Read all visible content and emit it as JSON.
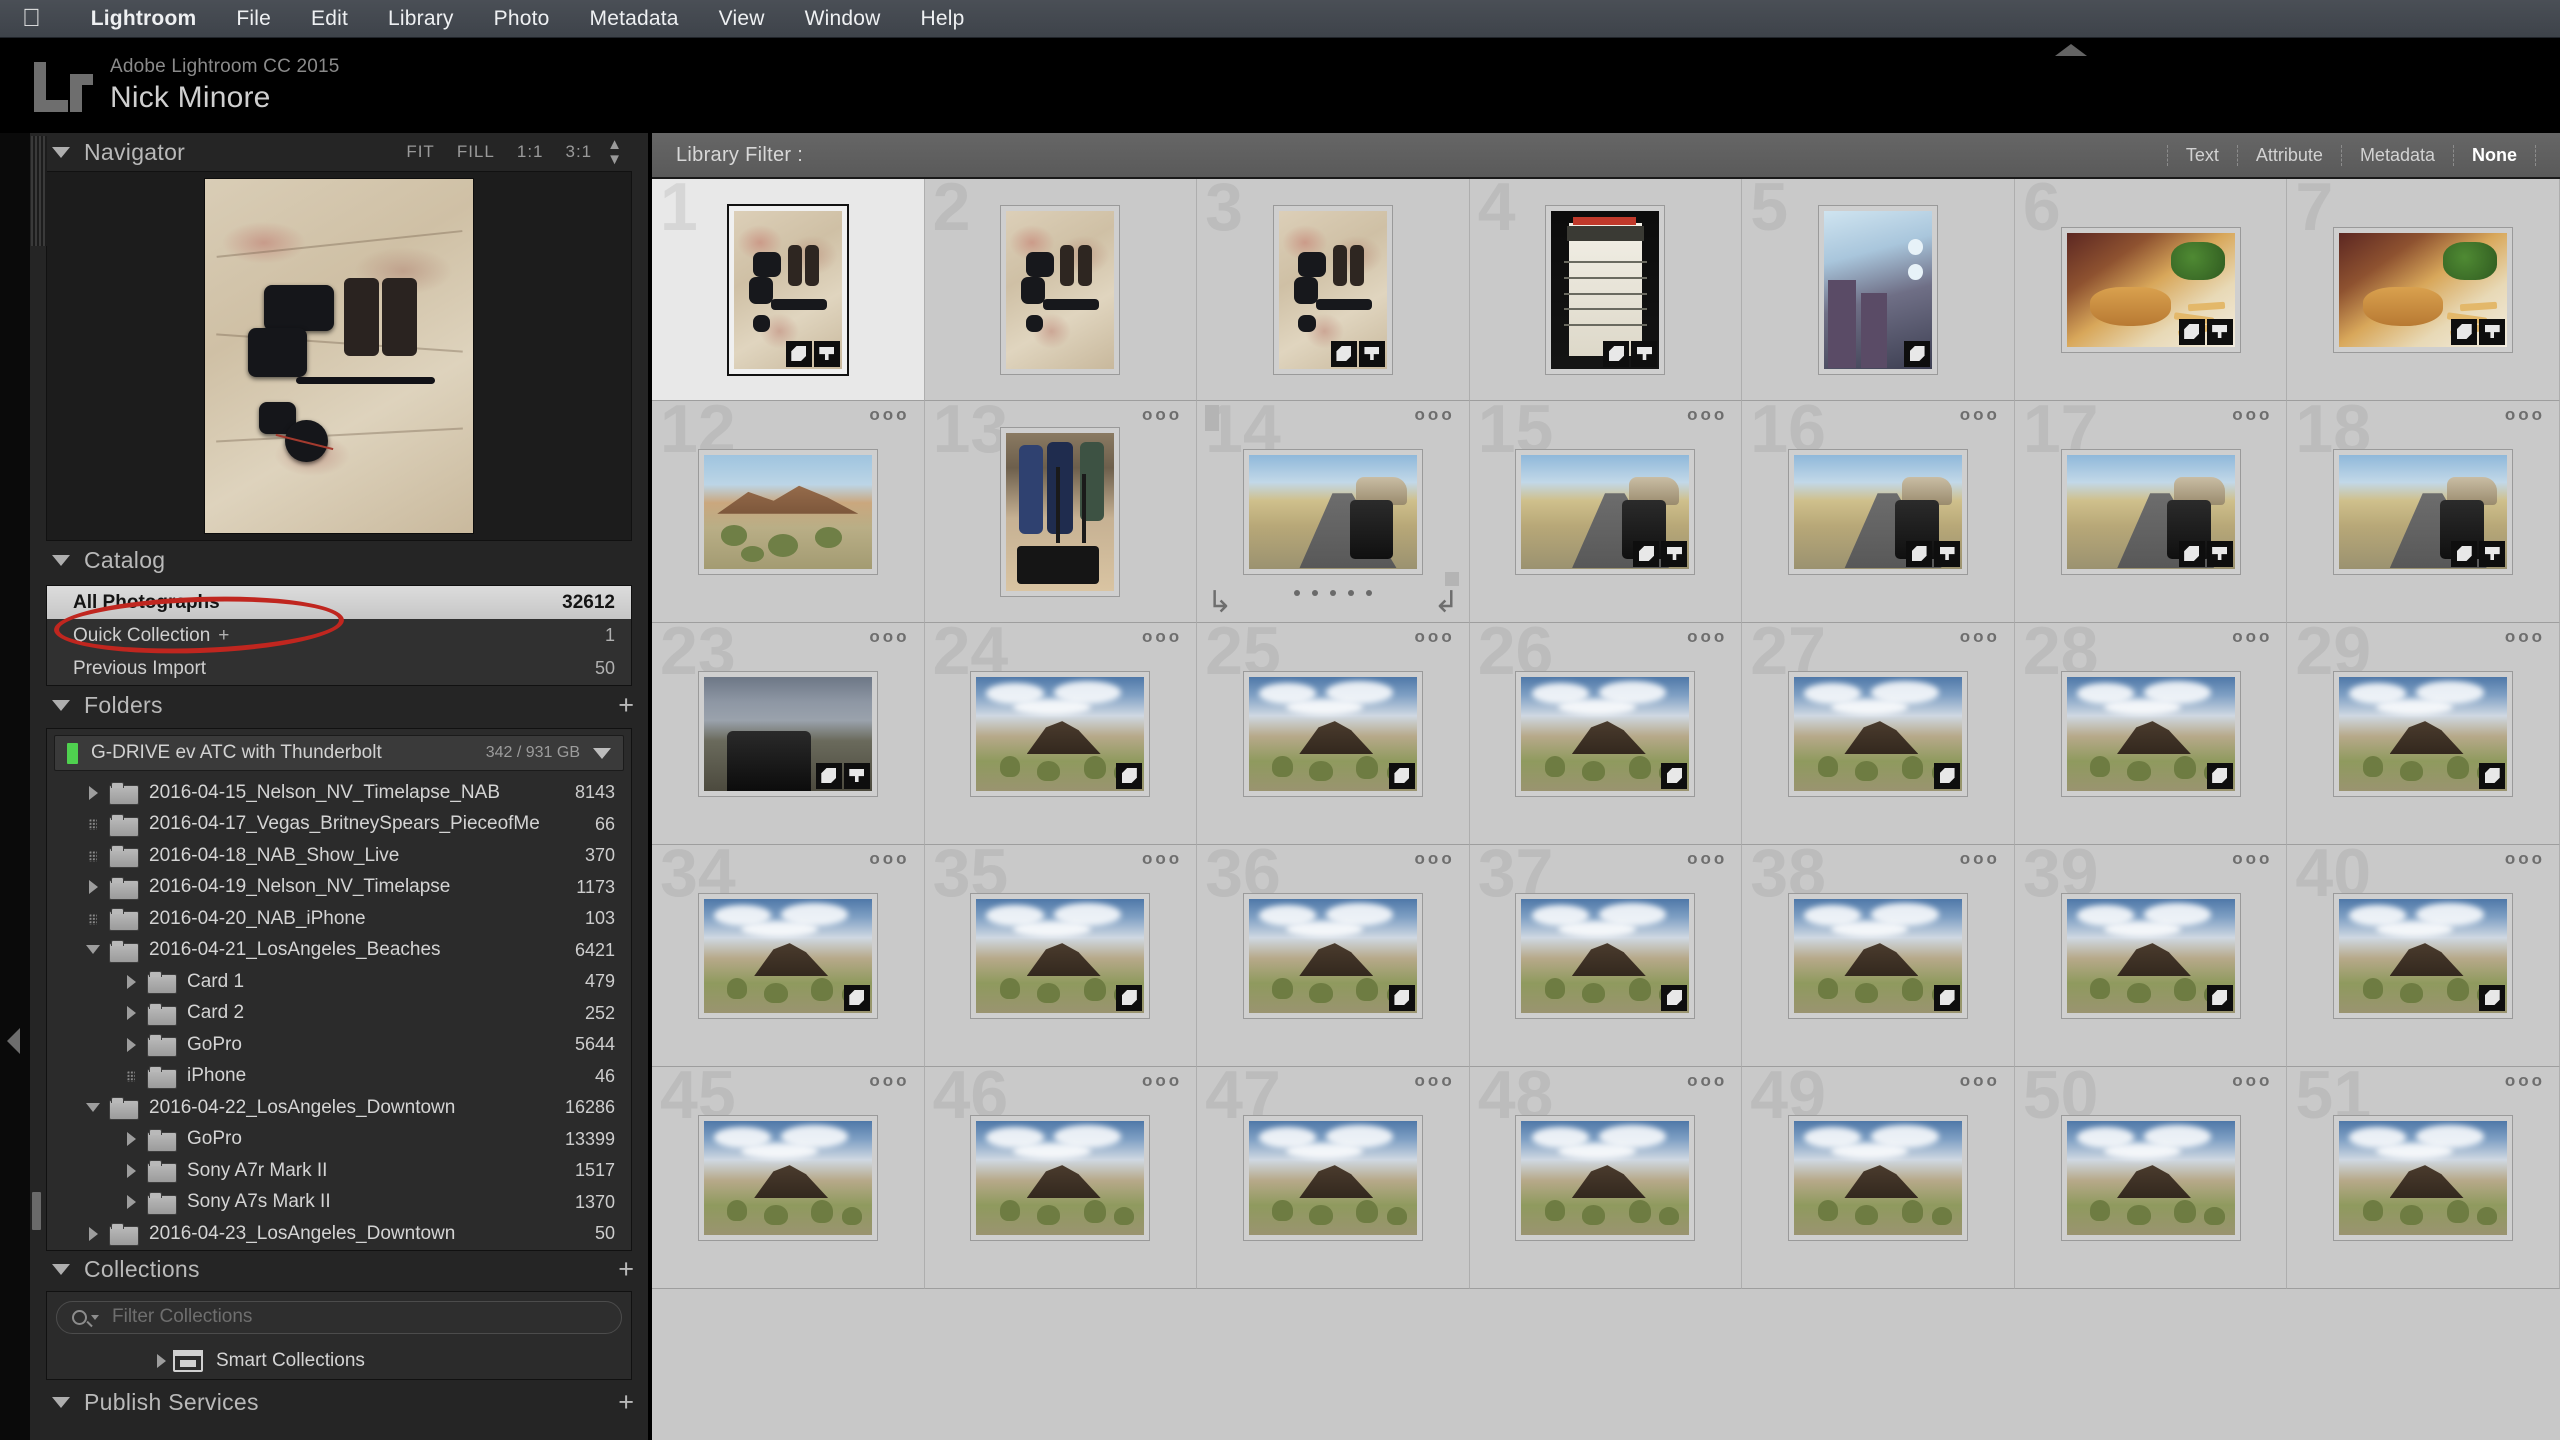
{
  "menubar": {
    "apple_glyph": "",
    "items": [
      "Lightroom",
      "File",
      "Edit",
      "Library",
      "Photo",
      "Metadata",
      "View",
      "Window",
      "Help"
    ]
  },
  "identity": {
    "logo": "Lr",
    "product": "Adobe Lightroom CC 2015",
    "user": "Nick Minore"
  },
  "navigator": {
    "title": "Navigator",
    "modes": [
      "FIT",
      "FILL",
      "1:1",
      "3:1"
    ],
    "stepper_icon": "stepper-icon"
  },
  "catalog": {
    "title": "Catalog",
    "rows": [
      {
        "label": "All Photographs",
        "count": "32612",
        "selected": true
      },
      {
        "label": "Quick Collection",
        "plus": "+",
        "count": "1",
        "selected": false
      },
      {
        "label": "Previous Import",
        "count": "50",
        "selected": false
      }
    ]
  },
  "folders": {
    "title": "Folders",
    "add_label": "+",
    "volume": {
      "name": "G-DRIVE ev ATC with Thunderbolt",
      "space": "342 / 931 GB"
    },
    "items": [
      {
        "label": "2016-04-15_Nelson_NV_Timelapse_NAB",
        "count": "8143",
        "twisty": "closed",
        "depth": 0
      },
      {
        "label": "2016-04-17_Vegas_BritneySpears_PieceofMe",
        "count": "66",
        "twisty": "dots",
        "depth": 0
      },
      {
        "label": "2016-04-18_NAB_Show_Live",
        "count": "370",
        "twisty": "dots",
        "depth": 0
      },
      {
        "label": "2016-04-19_Nelson_NV_Timelapse",
        "count": "1173",
        "twisty": "closed",
        "depth": 0
      },
      {
        "label": "2016-04-20_NAB_iPhone",
        "count": "103",
        "twisty": "dots",
        "depth": 0
      },
      {
        "label": "2016-04-21_LosAngeles_Beaches",
        "count": "6421",
        "twisty": "open",
        "depth": 0
      },
      {
        "label": "Card 1",
        "count": "479",
        "twisty": "closed",
        "depth": 1
      },
      {
        "label": "Card 2",
        "count": "252",
        "twisty": "closed",
        "depth": 1
      },
      {
        "label": "GoPro",
        "count": "5644",
        "twisty": "closed",
        "depth": 1
      },
      {
        "label": "iPhone",
        "count": "46",
        "twisty": "dots",
        "depth": 1
      },
      {
        "label": "2016-04-22_LosAngeles_Downtown",
        "count": "16286",
        "twisty": "open",
        "depth": 0
      },
      {
        "label": "GoPro",
        "count": "13399",
        "twisty": "closed",
        "depth": 1
      },
      {
        "label": "Sony A7r Mark II",
        "count": "1517",
        "twisty": "closed",
        "depth": 1
      },
      {
        "label": "Sony A7s Mark II",
        "count": "1370",
        "twisty": "closed",
        "depth": 1
      },
      {
        "label": "2016-04-23_LosAngeles_Downtown",
        "count": "50",
        "twisty": "closed",
        "depth": 0
      }
    ]
  },
  "collections": {
    "title": "Collections",
    "add_label": "+",
    "filter_placeholder": "Filter Collections",
    "filter_value": "",
    "smart": "Smart Collections"
  },
  "publish": {
    "title": "Publish Services",
    "add_label": "+"
  },
  "filterbar": {
    "label": "Library Filter :",
    "tabs": [
      {
        "label": "Text",
        "active": false
      },
      {
        "label": "Attribute",
        "active": false
      },
      {
        "label": "Metadata",
        "active": false
      },
      {
        "label": "None",
        "active": true
      }
    ]
  },
  "grid": {
    "cells": [
      {
        "n": "1",
        "art": "ph-map",
        "or": "p",
        "sel": true,
        "badges": [
          "tag",
          "crop"
        ]
      },
      {
        "n": "2",
        "art": "ph-map",
        "or": "p",
        "badges": []
      },
      {
        "n": "3",
        "art": "ph-map",
        "or": "p",
        "badges": [
          "tag",
          "crop"
        ]
      },
      {
        "n": "4",
        "art": "ph-ticket",
        "or": "p",
        "badges": [
          "tag",
          "crop"
        ]
      },
      {
        "n": "5",
        "art": "ph-plane",
        "or": "p",
        "badges": [
          "tag"
        ]
      },
      {
        "n": "6",
        "art": "ph-burger",
        "or": "l",
        "badges": [
          "tag",
          "crop"
        ]
      },
      {
        "n": "7",
        "art": "ph-burger",
        "or": "l",
        "badges": [
          "tag",
          "crop"
        ]
      },
      {
        "n": "12",
        "art": "ph-desert",
        "or": "l",
        "badges": [],
        "dots": "ooo"
      },
      {
        "n": "13",
        "art": "ph-crew",
        "or": "p",
        "badges": [],
        "dots": "ooo"
      },
      {
        "n": "14",
        "art": "ph-road",
        "or": "l",
        "badges": [],
        "dots": "ooo",
        "hover": true
      },
      {
        "n": "15",
        "art": "ph-road",
        "or": "l",
        "badges": [
          "tag",
          "crop"
        ],
        "dots": "ooo"
      },
      {
        "n": "16",
        "art": "ph-road",
        "or": "l",
        "badges": [
          "tag",
          "crop"
        ],
        "dots": "ooo"
      },
      {
        "n": "17",
        "art": "ph-road",
        "or": "l",
        "badges": [
          "tag",
          "crop"
        ],
        "dots": "ooo"
      },
      {
        "n": "18",
        "art": "ph-road",
        "or": "l",
        "badges": [
          "tag",
          "crop"
        ],
        "dots": "ooo"
      },
      {
        "n": "23",
        "art": "ph-storm",
        "or": "l",
        "badges": [
          "tag",
          "crop"
        ],
        "dots": "ooo"
      },
      {
        "n": "24",
        "art": "ph-mesa",
        "or": "l",
        "badges": [
          "tag"
        ],
        "dots": "ooo"
      },
      {
        "n": "25",
        "art": "ph-mesa",
        "or": "l",
        "badges": [
          "tag"
        ],
        "dots": "ooo"
      },
      {
        "n": "26",
        "art": "ph-mesa",
        "or": "l",
        "badges": [
          "tag"
        ],
        "dots": "ooo"
      },
      {
        "n": "27",
        "art": "ph-mesa",
        "or": "l",
        "badges": [
          "tag"
        ],
        "dots": "ooo"
      },
      {
        "n": "28",
        "art": "ph-mesa",
        "or": "l",
        "badges": [
          "tag"
        ],
        "dots": "ooo"
      },
      {
        "n": "29",
        "art": "ph-mesa",
        "or": "l",
        "badges": [
          "tag"
        ],
        "dots": "ooo"
      },
      {
        "n": "34",
        "art": "ph-mesa",
        "or": "l",
        "badges": [
          "tag"
        ],
        "dots": "ooo"
      },
      {
        "n": "35",
        "art": "ph-mesa",
        "or": "l",
        "badges": [
          "tag"
        ],
        "dots": "ooo"
      },
      {
        "n": "36",
        "art": "ph-mesa",
        "or": "l",
        "badges": [
          "tag"
        ],
        "dots": "ooo"
      },
      {
        "n": "37",
        "art": "ph-mesa",
        "or": "l",
        "badges": [
          "tag"
        ],
        "dots": "ooo"
      },
      {
        "n": "38",
        "art": "ph-mesa",
        "or": "l",
        "badges": [
          "tag"
        ],
        "dots": "ooo"
      },
      {
        "n": "39",
        "art": "ph-mesa",
        "or": "l",
        "badges": [
          "tag"
        ],
        "dots": "ooo"
      },
      {
        "n": "40",
        "art": "ph-mesa",
        "or": "l",
        "badges": [
          "tag"
        ],
        "dots": "ooo"
      },
      {
        "n": "45",
        "art": "ph-mesa",
        "or": "l",
        "badges": [],
        "dots": "ooo"
      },
      {
        "n": "46",
        "art": "ph-mesa",
        "or": "l",
        "badges": [],
        "dots": "ooo"
      },
      {
        "n": "47",
        "art": "ph-mesa",
        "or": "l",
        "badges": [],
        "dots": "ooo"
      },
      {
        "n": "48",
        "art": "ph-mesa",
        "or": "l",
        "badges": [],
        "dots": "ooo"
      },
      {
        "n": "49",
        "art": "ph-mesa",
        "or": "l",
        "badges": [],
        "dots": "ooo"
      },
      {
        "n": "50",
        "art": "ph-mesa",
        "or": "l",
        "badges": [],
        "dots": "ooo"
      },
      {
        "n": "51",
        "art": "ph-mesa",
        "or": "l",
        "badges": [],
        "dots": "ooo"
      }
    ]
  },
  "annotation": {
    "shape": "red-ellipse",
    "color": "#c0261f",
    "targets": "All Photographs"
  }
}
